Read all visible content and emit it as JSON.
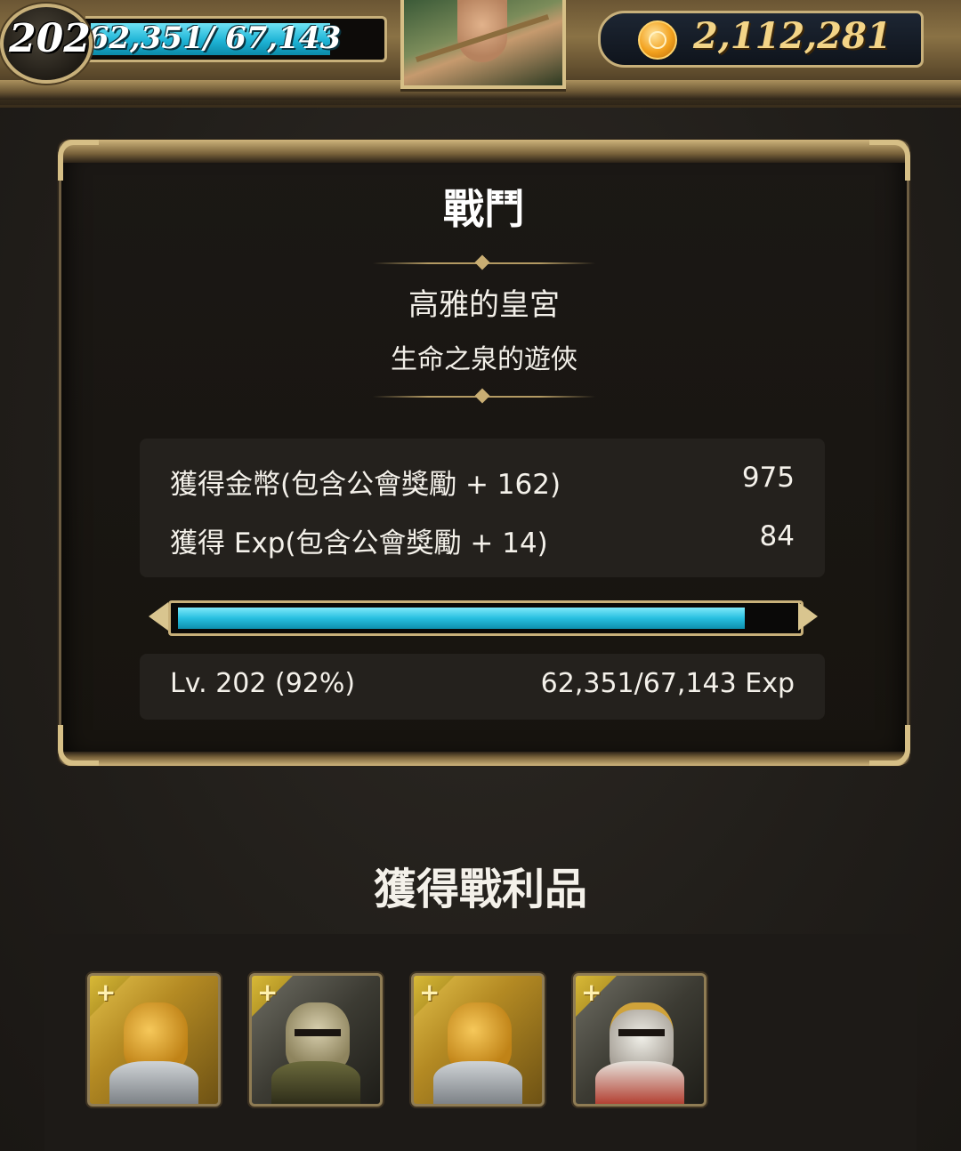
{
  "hud": {
    "player_level": "202",
    "exp_text": "62,351/ 67,143",
    "exp_fraction": 0.928,
    "gold": "2,112,281",
    "gold_icon": "gold-coin-icon",
    "portrait_icon": "ranger-portrait-icon"
  },
  "battle": {
    "title": "戰鬥",
    "stage_name": "高雅的皇宮",
    "quest_name": "生命之泉的遊俠",
    "rewards": [
      {
        "label": "獲得金幣(包含公會獎勵 + 162)",
        "value": "975"
      },
      {
        "label": "獲得 Exp(包含公會獎勵 + 14)",
        "value": "84"
      }
    ],
    "progress_fraction": 0.92,
    "level_text": "Lv. 202 (92%)",
    "exp_detail": "62,351/67,143 Exp"
  },
  "loot": {
    "title": "獲得戰利品",
    "items": [
      {
        "icon": "golden-dragon-warrior-card-icon",
        "style": "gold",
        "art": "dragon",
        "badge": "+"
      },
      {
        "icon": "armored-knight-card-icon",
        "style": "dark",
        "art": "knight",
        "badge": "+"
      },
      {
        "icon": "golden-dragon-warrior-card-icon",
        "style": "gold",
        "art": "dragon",
        "badge": "+"
      },
      {
        "icon": "crowned-paladin-card-icon",
        "style": "dark",
        "art": "paladin",
        "badge": "+"
      }
    ]
  },
  "colors": {
    "exp_bar": "#1fb4d6",
    "gold_text": "#f3d487",
    "frame_gold": "#c8b07a",
    "panel_bg": "#1b1815"
  }
}
